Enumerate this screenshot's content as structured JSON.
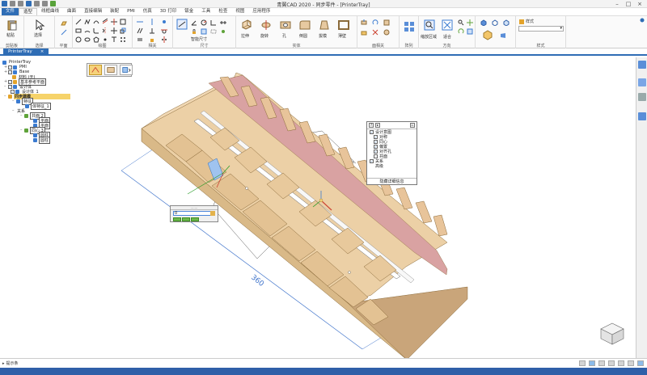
{
  "window": {
    "title": "青翼CAD 2020 - 同步零件 - [PrinterTray]"
  },
  "menu": {
    "tabs": [
      "文件",
      "造型",
      "线框曲线",
      "曲面",
      "直接编辑",
      "装配",
      "PMI",
      "仿真",
      "3D 打印",
      "钣金",
      "工具",
      "检查",
      "视图",
      "应用程序"
    ],
    "file_label": "文件"
  },
  "ribbon": {
    "groups": [
      {
        "label": "剪贴板",
        "buttons": [
          "粘贴"
        ]
      },
      {
        "label": "选择",
        "buttons": [
          "选择"
        ]
      },
      {
        "label": "平面",
        "buttons": []
      },
      {
        "label": "绘图",
        "buttons": []
      },
      {
        "label": "相关",
        "buttons": []
      },
      {
        "label": "尺寸",
        "buttons": [
          "智能尺寸"
        ]
      },
      {
        "label": "实体",
        "buttons": [
          "拉伸",
          "旋转",
          "孔",
          "倒圆",
          "拔模",
          "薄壁"
        ]
      },
      {
        "label": "面相关",
        "buttons": []
      },
      {
        "label": "阵列",
        "buttons": []
      },
      {
        "label": "方向",
        "buttons": [
          "缩放区域",
          "适合"
        ]
      },
      {
        "label": "样式",
        "buttons": [
          "样式"
        ]
      }
    ],
    "style_select": ""
  },
  "document": {
    "tab_label": "PrinterTray"
  },
  "tree": {
    "root": "PrinterTray",
    "items": [
      {
        "label": "PMI",
        "indent": 1
      },
      {
        "label": "Base",
        "indent": 1
      },
      {
        "label": "材料 (无)",
        "indent": 1
      },
      {
        "label": "基本参考平面",
        "indent": 1
      },
      {
        "label": "设计体",
        "indent": 1
      },
      {
        "label": "设计体_1",
        "indent": 2
      },
      {
        "label": "同步建模",
        "indent": 1
      },
      {
        "label": "特征",
        "indent": 2
      },
      {
        "label": "体特征_1",
        "indent": 3
      },
      {
        "label": "关系",
        "indent": 2
      },
      {
        "label": "共面 2",
        "indent": 3
      },
      {
        "label": "平面",
        "indent": 4
      },
      {
        "label": "平面",
        "indent": 4
      },
      {
        "label": "同心 3",
        "indent": 3
      },
      {
        "label": "圆柱",
        "indent": 4
      },
      {
        "label": "圆柱",
        "indent": 4
      }
    ]
  },
  "filter_panel": {
    "items": [
      {
        "label": "设计意图",
        "indent": 0
      },
      {
        "label": "对称",
        "indent": 1
      },
      {
        "label": "同心",
        "indent": 1
      },
      {
        "label": "偏置",
        "indent": 1
      },
      {
        "label": "对齐孔",
        "indent": 1
      },
      {
        "label": "共面",
        "indent": 1
      },
      {
        "label": "关系",
        "indent": 0
      },
      {
        "label": "高级",
        "indent": 0
      }
    ],
    "footer": "隐藏详细信息"
  },
  "dimension": {
    "value": "360",
    "input_value": "0"
  },
  "status": {
    "prompt": "提示条"
  },
  "colors": {
    "accent": "#2f6db5",
    "model_face": "#e7c9a0",
    "model_dark": "#c9a57a",
    "rib_pink": "#d9a2a2"
  }
}
